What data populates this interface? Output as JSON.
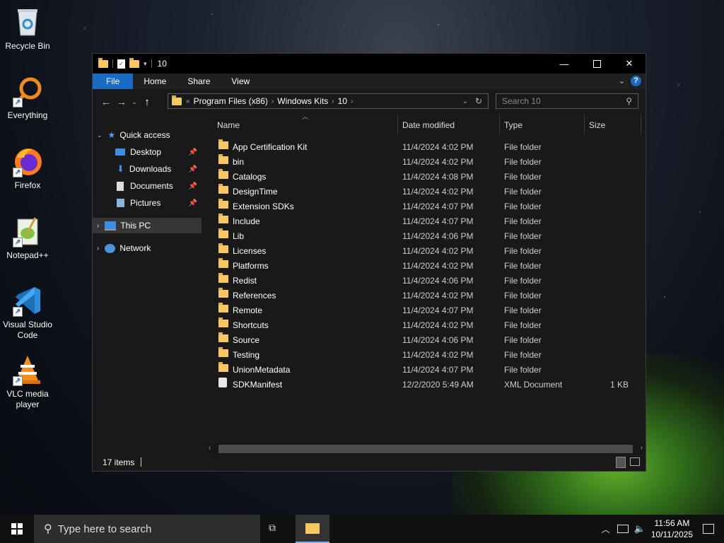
{
  "desktop": {
    "icons": [
      {
        "label": "Recycle Bin"
      },
      {
        "label": "Everything"
      },
      {
        "label": "Firefox"
      },
      {
        "label": "Notepad++"
      },
      {
        "label": "Visual Studio Code"
      },
      {
        "label": "VLC media player"
      }
    ]
  },
  "window": {
    "title": "10",
    "ribbon_tabs": [
      "File",
      "Home",
      "Share",
      "View"
    ],
    "address": {
      "prefix": "«",
      "crumbs": [
        "Program Files (x86)",
        "Windows Kits",
        "10"
      ]
    },
    "search_placeholder": "Search 10",
    "nav": {
      "quick_access": "Quick access",
      "quick_items": [
        "Desktop",
        "Downloads",
        "Documents",
        "Pictures"
      ],
      "this_pc": "This PC",
      "network": "Network"
    },
    "columns": [
      "Name",
      "Date modified",
      "Type",
      "Size"
    ],
    "files": [
      {
        "name": "App Certification Kit",
        "date": "11/4/2024 4:02 PM",
        "type": "File folder",
        "size": ""
      },
      {
        "name": "bin",
        "date": "11/4/2024 4:02 PM",
        "type": "File folder",
        "size": ""
      },
      {
        "name": "Catalogs",
        "date": "11/4/2024 4:08 PM",
        "type": "File folder",
        "size": ""
      },
      {
        "name": "DesignTime",
        "date": "11/4/2024 4:02 PM",
        "type": "File folder",
        "size": ""
      },
      {
        "name": "Extension SDKs",
        "date": "11/4/2024 4:07 PM",
        "type": "File folder",
        "size": ""
      },
      {
        "name": "Include",
        "date": "11/4/2024 4:07 PM",
        "type": "File folder",
        "size": ""
      },
      {
        "name": "Lib",
        "date": "11/4/2024 4:06 PM",
        "type": "File folder",
        "size": ""
      },
      {
        "name": "Licenses",
        "date": "11/4/2024 4:02 PM",
        "type": "File folder",
        "size": ""
      },
      {
        "name": "Platforms",
        "date": "11/4/2024 4:02 PM",
        "type": "File folder",
        "size": ""
      },
      {
        "name": "Redist",
        "date": "11/4/2024 4:06 PM",
        "type": "File folder",
        "size": ""
      },
      {
        "name": "References",
        "date": "11/4/2024 4:02 PM",
        "type": "File folder",
        "size": ""
      },
      {
        "name": "Remote",
        "date": "11/4/2024 4:07 PM",
        "type": "File folder",
        "size": ""
      },
      {
        "name": "Shortcuts",
        "date": "11/4/2024 4:02 PM",
        "type": "File folder",
        "size": ""
      },
      {
        "name": "Source",
        "date": "11/4/2024 4:06 PM",
        "type": "File folder",
        "size": ""
      },
      {
        "name": "Testing",
        "date": "11/4/2024 4:02 PM",
        "type": "File folder",
        "size": ""
      },
      {
        "name": "UnionMetadata",
        "date": "11/4/2024 4:07 PM",
        "type": "File folder",
        "size": ""
      },
      {
        "name": "SDKManifest",
        "date": "12/2/2020 5:49 AM",
        "type": "XML Document",
        "size": "1 KB"
      }
    ],
    "status": "17 items"
  },
  "taskbar": {
    "search_placeholder": "Type here to search",
    "time": "11:56 AM",
    "date": "10/11/2025"
  }
}
